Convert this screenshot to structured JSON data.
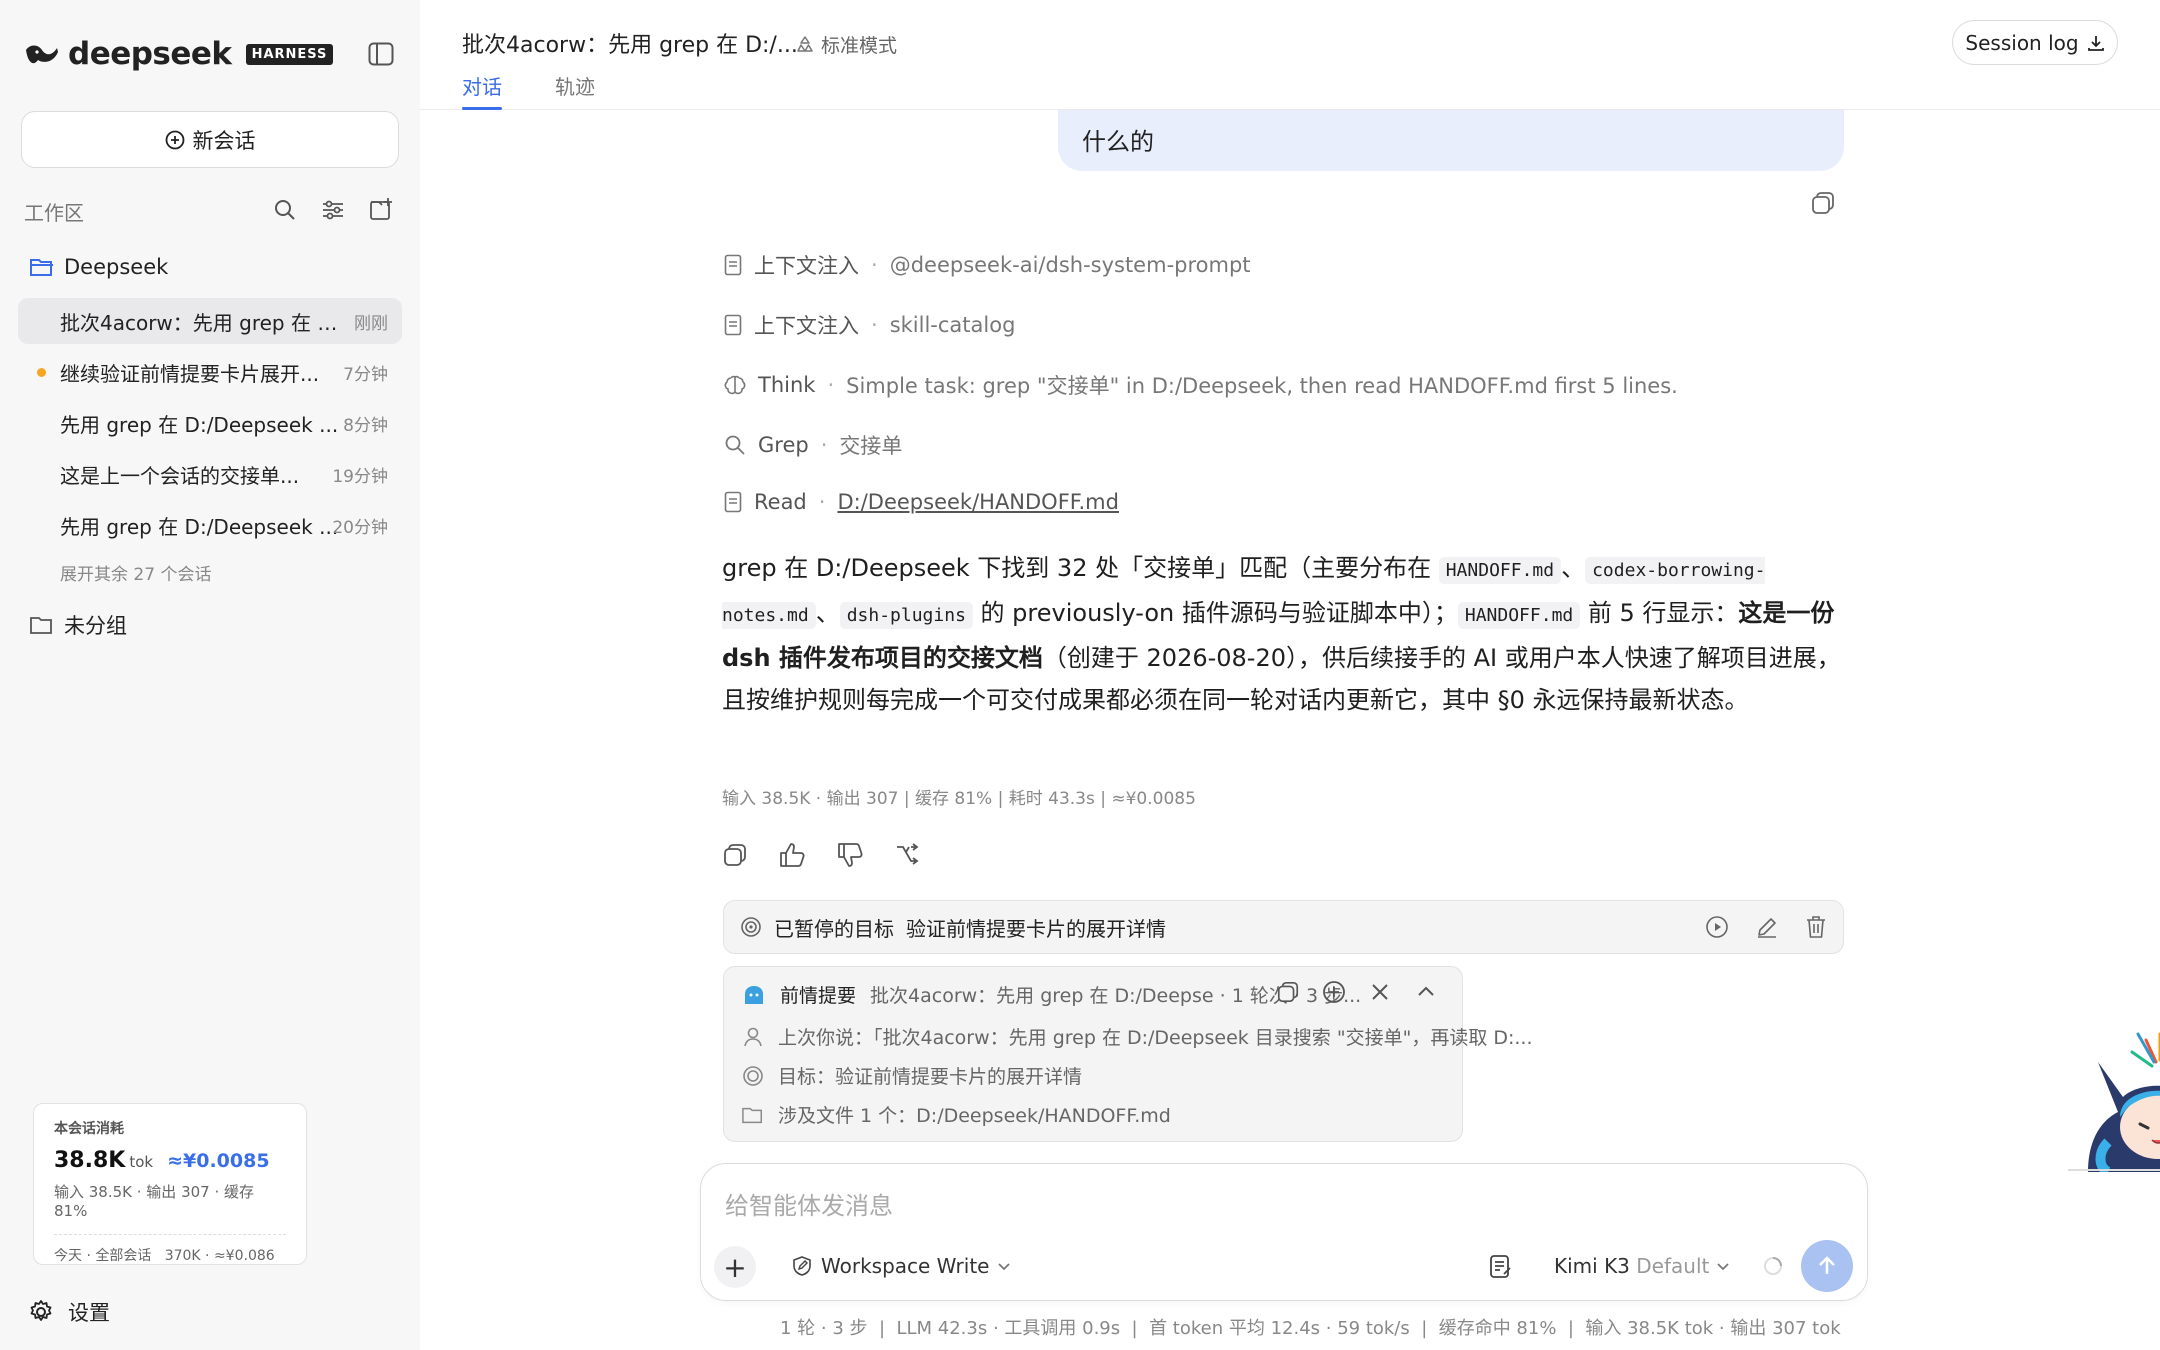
{
  "sidebar": {
    "logo": "deepseek",
    "logo_badge": "HARNESS",
    "new_chat": "新会话",
    "workspace_title": "工作区",
    "folder_name": "Deepseek",
    "sessions": [
      {
        "title": "批次4acorw：先用 grep 在 D...",
        "time": "刚刚"
      },
      {
        "title": "继续验证前情提要卡片展开...",
        "time": "7分钟"
      },
      {
        "title": "先用 grep 在 D:/Deepseek ...",
        "time": "8分钟"
      },
      {
        "title": "这是上一个会话的交接单...",
        "time": "19分钟"
      },
      {
        "title": "先用 grep 在 D:/Deepseek ...",
        "time": "20分钟"
      }
    ],
    "expand_more": "展开其余 27 个会话",
    "ungrouped": "未分组",
    "usage": {
      "heading": "本会话消耗",
      "tokens": "38.8K",
      "tokens_unit": "tok",
      "cost": "≈¥0.0085",
      "detail": "输入 38.5K · 输出 307 · 缓存 81%",
      "today": "今天 · 全部会话   370K · ≈¥0.086"
    },
    "settings": "设置"
  },
  "header": {
    "title": "批次4acorw：先用 grep 在 D:/...",
    "mode": "标准模式",
    "tabs": [
      "对话",
      "轨迹"
    ],
    "session_log": "Session log"
  },
  "chat": {
    "user_bubble": "什么的",
    "steps": [
      {
        "name": "上下文注入",
        "detail": "@deepseek-ai/dsh-system-prompt"
      },
      {
        "name": "上下文注入",
        "detail": "skill-catalog"
      },
      {
        "name": "Think",
        "detail": "Simple task: grep \"交接单\" in D:/Deepseek, then read HANDOFF.md first 5 lines."
      },
      {
        "name": "Grep",
        "detail": "交接单"
      },
      {
        "name": "Read",
        "detail": "D:/Deepseek/HANDOFF.md"
      }
    ],
    "answer": {
      "p1": "grep 在 D:/Deepseek 下找到 32 处「交接单」匹配（主要分布在 ",
      "c1": "HANDOFF.md",
      "p2": "、",
      "c2": "codex-borrowing-notes.md",
      "p3": "、",
      "c3": "dsh-plugins",
      "p4": " 的 previously-on 插件源码与验证脚本中）；",
      "c4": "HANDOFF.md",
      "p5": " 前 5 行显示：",
      "bold": "这是一份 dsh 插件发布项目的交接文档",
      "p6": "（创建于 2026-08-20），供后续接手的 AI 或用户本人快速了解项目进展，且按维护规则每完成一个可交付成果都必须在同一轮对话内更新它，其中 §0 永远保持最新状态。"
    },
    "stats": "输入 38.5K · 输出 307 | 缓存 81% | 耗时 43.3s | ≈¥0.0085",
    "goal": {
      "label": "已暂停的目标",
      "text": "验证前情提要卡片的展开详情"
    },
    "recap": {
      "title": "前情提要",
      "meta": "批次4acorw：先用 grep 在 D:/Deepse · 1 轮次 · 3 步...",
      "rows": [
        "上次你说：「批次4acorw：先用 grep 在 D:/Deepseek 目录搜索 \"交接单\"，再读取 D:...",
        "目标：验证前情提要卡片的展开详情",
        "涉及文件 1 个：D:/Deepseek/HANDOFF.md"
      ]
    }
  },
  "composer": {
    "placeholder": "给智能体发消息",
    "workspace_mode": "Workspace Write",
    "model": "Kimi K3",
    "model_tag": "Default"
  },
  "footer": "1 轮 · 3 步  |  LLM 42.3s · 工具调用 0.9s  |  首 token 平均 12.4s · 59 tok/s  |  缓存命中 81%  |  输入 38.5K tok · 输出 307 tok",
  "colors": {
    "accent": "#3a6ee8",
    "bubble": "#e8eefc",
    "sidebar": "#f7f7f8",
    "dot": "#f5a623"
  }
}
